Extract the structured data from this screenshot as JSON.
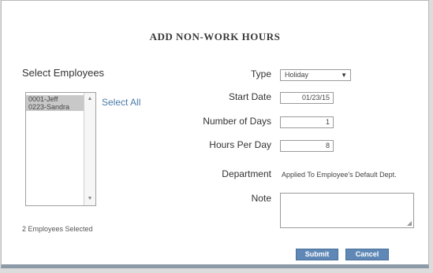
{
  "dialog": {
    "title": "ADD NON-WORK HOURS"
  },
  "employees": {
    "label": "Select Employees",
    "items": [
      "0001-Jeff",
      "0223-Sandra"
    ],
    "select_all": "Select All",
    "selected_count_text": "2 Employees Selected"
  },
  "form": {
    "type": {
      "label": "Type",
      "value": "Holiday"
    },
    "start_date": {
      "label": "Start Date",
      "value": "01/23/15"
    },
    "number_of_days": {
      "label": "Number of Days",
      "value": "1"
    },
    "hours_per_day": {
      "label": "Hours Per Day",
      "value": "8"
    },
    "department": {
      "label": "Department",
      "value": "Applied To Employee's Default Dept."
    },
    "note": {
      "label": "Note",
      "value": ""
    }
  },
  "buttons": {
    "submit": "Submit",
    "cancel": "Cancel"
  }
}
